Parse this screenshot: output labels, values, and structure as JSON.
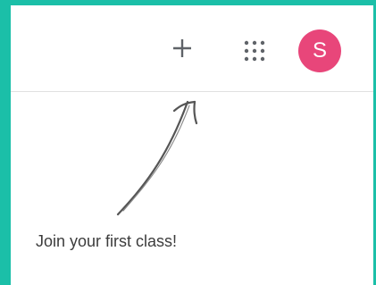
{
  "toolbar": {
    "add_icon": "plus-icon",
    "apps_icon": "grid-icon",
    "avatar_initial": "S",
    "avatar_color": "#e8467a"
  },
  "empty_state": {
    "message": "Join your first class!",
    "pointer_icon": "hand-drawn-arrow-icon"
  },
  "colors": {
    "frame": "#1bbfa8",
    "background": "#ffffff",
    "divider": "#e0e0e0",
    "icon": "#5f6368",
    "text": "#3c3c3c"
  }
}
